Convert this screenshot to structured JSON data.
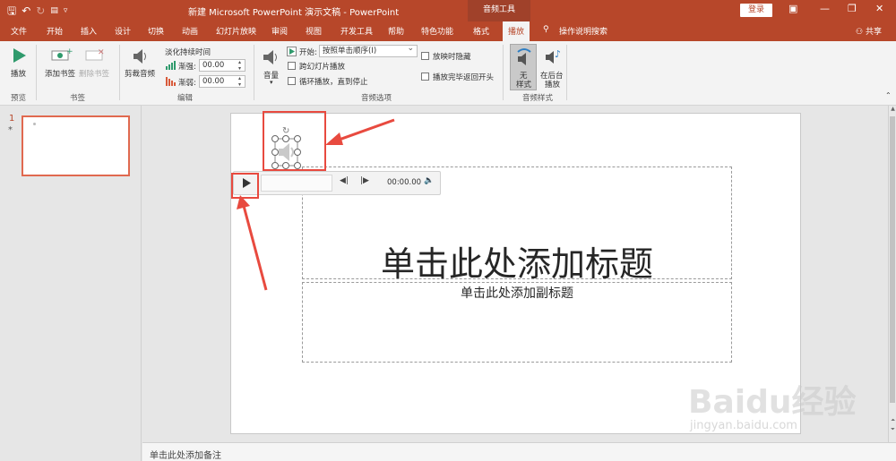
{
  "titlebar": {
    "doc_title": "新建 Microsoft PowerPoint 演示文稿 - PowerPoint",
    "context_tab_header": "音频工具",
    "login": "登录"
  },
  "tabs": [
    "文件",
    "开始",
    "插入",
    "设计",
    "切换",
    "动画",
    "幻灯片放映",
    "审阅",
    "视图",
    "开发工具",
    "帮助",
    "特色功能",
    "格式",
    "播放",
    "操作说明搜索"
  ],
  "active_tab": "播放",
  "share": "共享",
  "ribbon": {
    "preview": {
      "play_label": "播放",
      "group_label": "预览"
    },
    "bookmarks": {
      "add_label": "添加书签",
      "remove_label": "删除书签",
      "group_label": "书签"
    },
    "editing": {
      "trim_label": "剪裁音频",
      "fade_title": "淡化持续时间",
      "fade_in_label": "渐强:",
      "fade_in_value": "00.00",
      "fade_out_label": "渐弱:",
      "fade_out_value": "00.00",
      "group_label": "编辑"
    },
    "audio_options": {
      "volume_label": "音量",
      "start_label": "开始:",
      "start_value": "按照单击顺序(I)",
      "play_across_slides": "跨幻灯片播放",
      "loop_until_stopped": "循环播放，直到停止",
      "hide_during_show": "放映时隐藏",
      "rewind_after_playing": "播放完毕返回开头",
      "group_label": "音频选项"
    },
    "audio_styles": {
      "no_style_line1": "无",
      "no_style_line2": "样式",
      "play_bg_line1": "在后台",
      "play_bg_line2": "播放",
      "group_label": "音频样式"
    }
  },
  "thumbnails": {
    "slide_number": "1",
    "marker": "*"
  },
  "slide": {
    "title_placeholder": "单击此处添加标题",
    "subtitle_placeholder": "单击此处添加副标题"
  },
  "player": {
    "time": "00:00.00"
  },
  "notes_placeholder": "单击此处添加备注",
  "watermark": {
    "main": "Baidu经验",
    "sub": "jingyan.baidu.com"
  }
}
